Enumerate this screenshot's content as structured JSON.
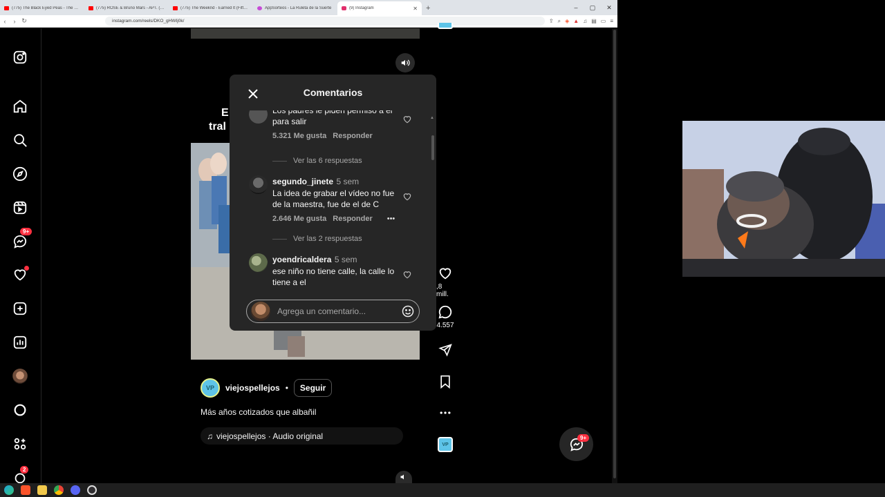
{
  "browser": {
    "tabs": [
      {
        "title": "(775) The Black Eyed Peas - The Time (",
        "color": "#ff0000",
        "active": false
      },
      {
        "title": "(775) ROSÉ & Bruno Mars - APT. (Offi",
        "color": "#ff0000",
        "active": false
      },
      {
        "title": "(775) The Weeknd - Earned It (Fifty Sh",
        "color": "#ff0000",
        "active": false
      },
      {
        "title": "AppSorteos - La Ruleta de la Suerte",
        "color": "#c64bd6",
        "active": false
      },
      {
        "title": "(9) Instagram",
        "color": "#e1306c",
        "active": true
      }
    ],
    "new_tab": "+",
    "window_controls": {
      "minimize": "–",
      "maximize": "▢",
      "close": "✕"
    },
    "url": "instagram.com/reels/DKO_gHWIj0k/"
  },
  "sidebar": {
    "items": [
      {
        "icon": "instagram-logo-icon"
      },
      {
        "icon": "home-icon"
      },
      {
        "icon": "search-icon"
      },
      {
        "icon": "explore-icon"
      },
      {
        "icon": "reels-icon"
      },
      {
        "icon": "messenger-icon",
        "badge": "9+"
      },
      {
        "icon": "heart-icon",
        "dot": true
      },
      {
        "icon": "create-icon"
      },
      {
        "icon": "dashboard-icon"
      },
      {
        "icon": "profile-avatar"
      },
      {
        "icon": "threads-icon"
      },
      {
        "icon": "more-icon"
      },
      {
        "icon": "meta-icon",
        "badge": "2"
      }
    ]
  },
  "reel": {
    "overlay_line1": "E",
    "overlay_line2": "tral",
    "author": "viejospellejos",
    "author_avatar": "VP",
    "separator": "•",
    "follow_label": "Seguir",
    "caption": "Más años cotizados que albañil",
    "audio": "viejospellejos · Audio original"
  },
  "actions": {
    "likes": ",8 mill.",
    "comments": "4.557"
  },
  "comments_modal": {
    "title": "Comentarios",
    "comments": [
      {
        "text_line1": "Los padres le piden permiso a él",
        "text_line2": "para salir",
        "likes": "5.321 Me gusta",
        "reply": "Responder",
        "view_replies": "Ver las 6 respuestas"
      },
      {
        "user": "segundo_jinete",
        "time": "5 sem",
        "text_line1": "La idea de grabar el vídeo no fue",
        "text_line2": "de la maestra, fue de el de C",
        "likes": "2.646 Me gusta",
        "reply": "Responder",
        "more": "•••",
        "view_replies": "Ver las 2 respuestas"
      },
      {
        "user": "yoendricaldera",
        "time": "5 sem",
        "text_line1": "ese niño no tiene calle, la calle lo",
        "text_line2": "tiene a el"
      }
    ],
    "input_placeholder": "Agrega un comentario..."
  },
  "fab": {
    "badge": "9+"
  },
  "colors": {
    "accent_badge": "#ff3040",
    "modal_bg": "#262626",
    "page_bg": "#000000"
  }
}
